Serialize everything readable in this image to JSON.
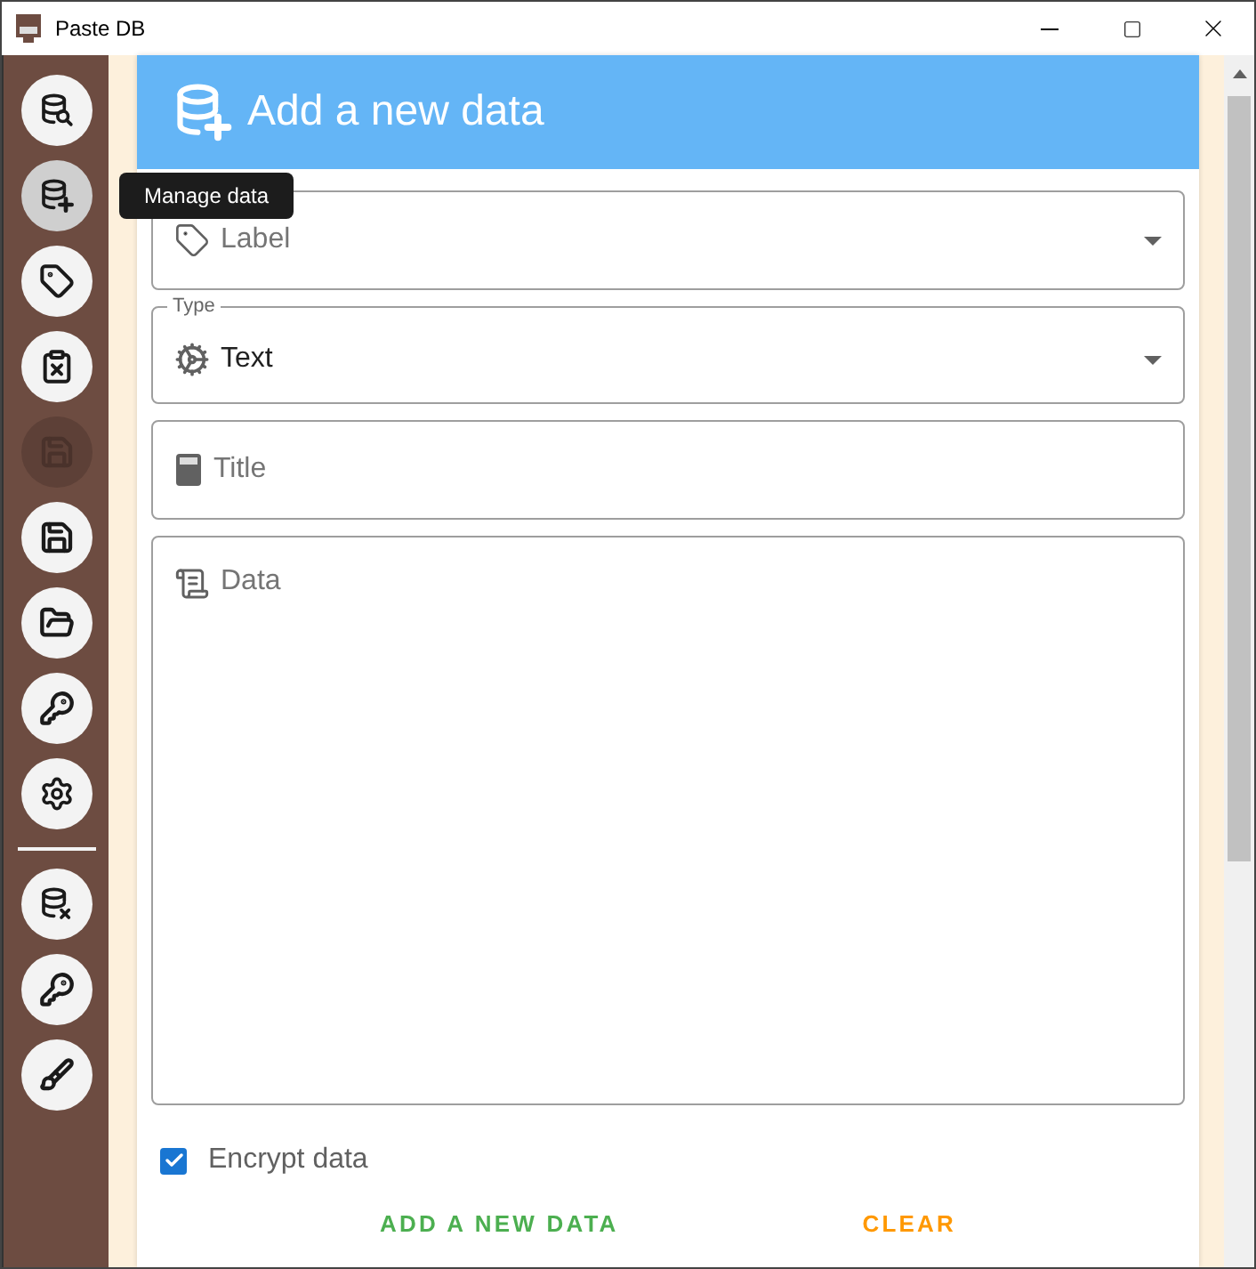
{
  "window": {
    "title": "Paste DB"
  },
  "sidebar": {
    "groups": [
      [
        {
          "selected": false,
          "disabled": false
        },
        {
          "selected": true,
          "disabled": false
        },
        {
          "selected": false,
          "disabled": false
        },
        {
          "selected": false,
          "disabled": false
        },
        {
          "selected": false,
          "disabled": true
        },
        {
          "selected": false,
          "disabled": false
        },
        {
          "selected": false,
          "disabled": false
        },
        {
          "selected": false,
          "disabled": false
        },
        {
          "selected": false,
          "disabled": false
        }
      ],
      [
        {
          "selected": false,
          "disabled": false
        },
        {
          "selected": false,
          "disabled": false
        },
        {
          "selected": false,
          "disabled": false
        }
      ]
    ]
  },
  "tooltip": {
    "text": "Manage data"
  },
  "form": {
    "title": "Add a new data",
    "fields": [
      {
        "kind": "select",
        "placeholder": "Label"
      },
      {
        "kind": "select",
        "legend": "Type",
        "value": "Text"
      },
      {
        "kind": "input",
        "placeholder": "Title"
      },
      {
        "kind": "textarea",
        "placeholder": "Data"
      }
    ],
    "encrypt": {
      "label": "Encrypt data",
      "checked": true
    },
    "buttons": [
      {
        "label": "ADD A NEW DATA",
        "color": "#4caf50"
      },
      {
        "label": "CLEAR",
        "color": "#ff9800"
      }
    ]
  }
}
